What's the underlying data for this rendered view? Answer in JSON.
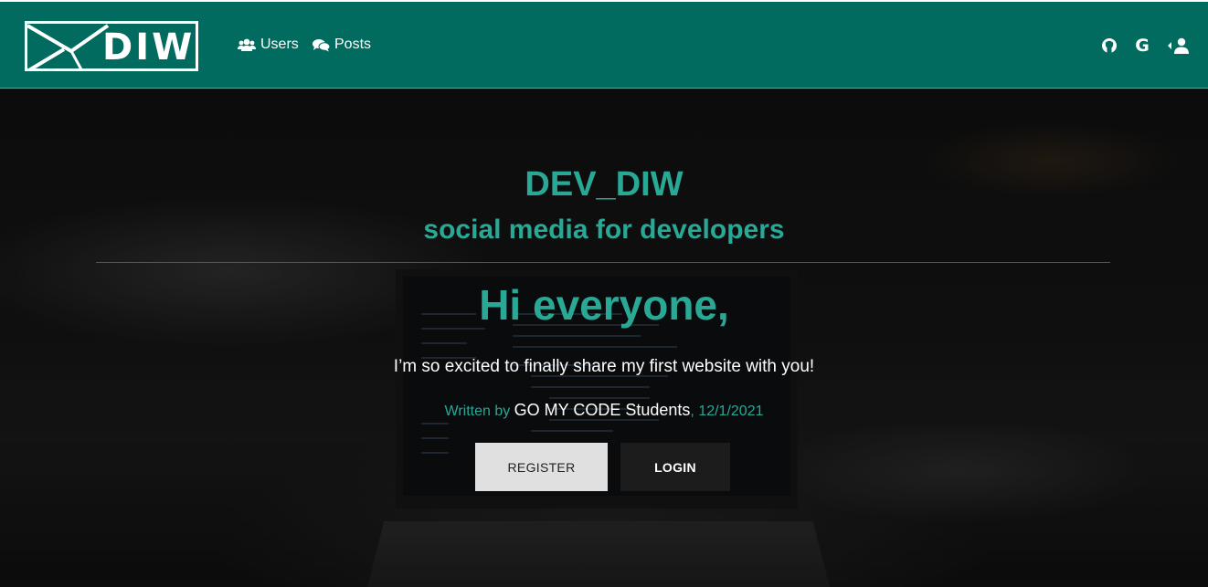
{
  "navbar": {
    "logo_text": "DIW",
    "background_color": "#006b5e",
    "links": [
      {
        "label": "Users",
        "icon": "users-icon"
      },
      {
        "label": "Posts",
        "icon": "comments-icon"
      }
    ],
    "right_icons": [
      "github-icon",
      "google-icon",
      "sign-in-user-icon"
    ],
    "google_letter": "G"
  },
  "hero": {
    "title": "DEV_DIW",
    "subtitle": "social media for developers",
    "greeting": "Hi everyone,",
    "lead": "I’m so excited to finally share my first website with you!",
    "byline": {
      "prefix": "Written by ",
      "author": "GO MY CODE Students",
      "separator": ", ",
      "date": "12/1/2021"
    },
    "accent_color": "#2aa896",
    "buttons": {
      "register": "REGISTER",
      "login": "LOGIN"
    }
  }
}
